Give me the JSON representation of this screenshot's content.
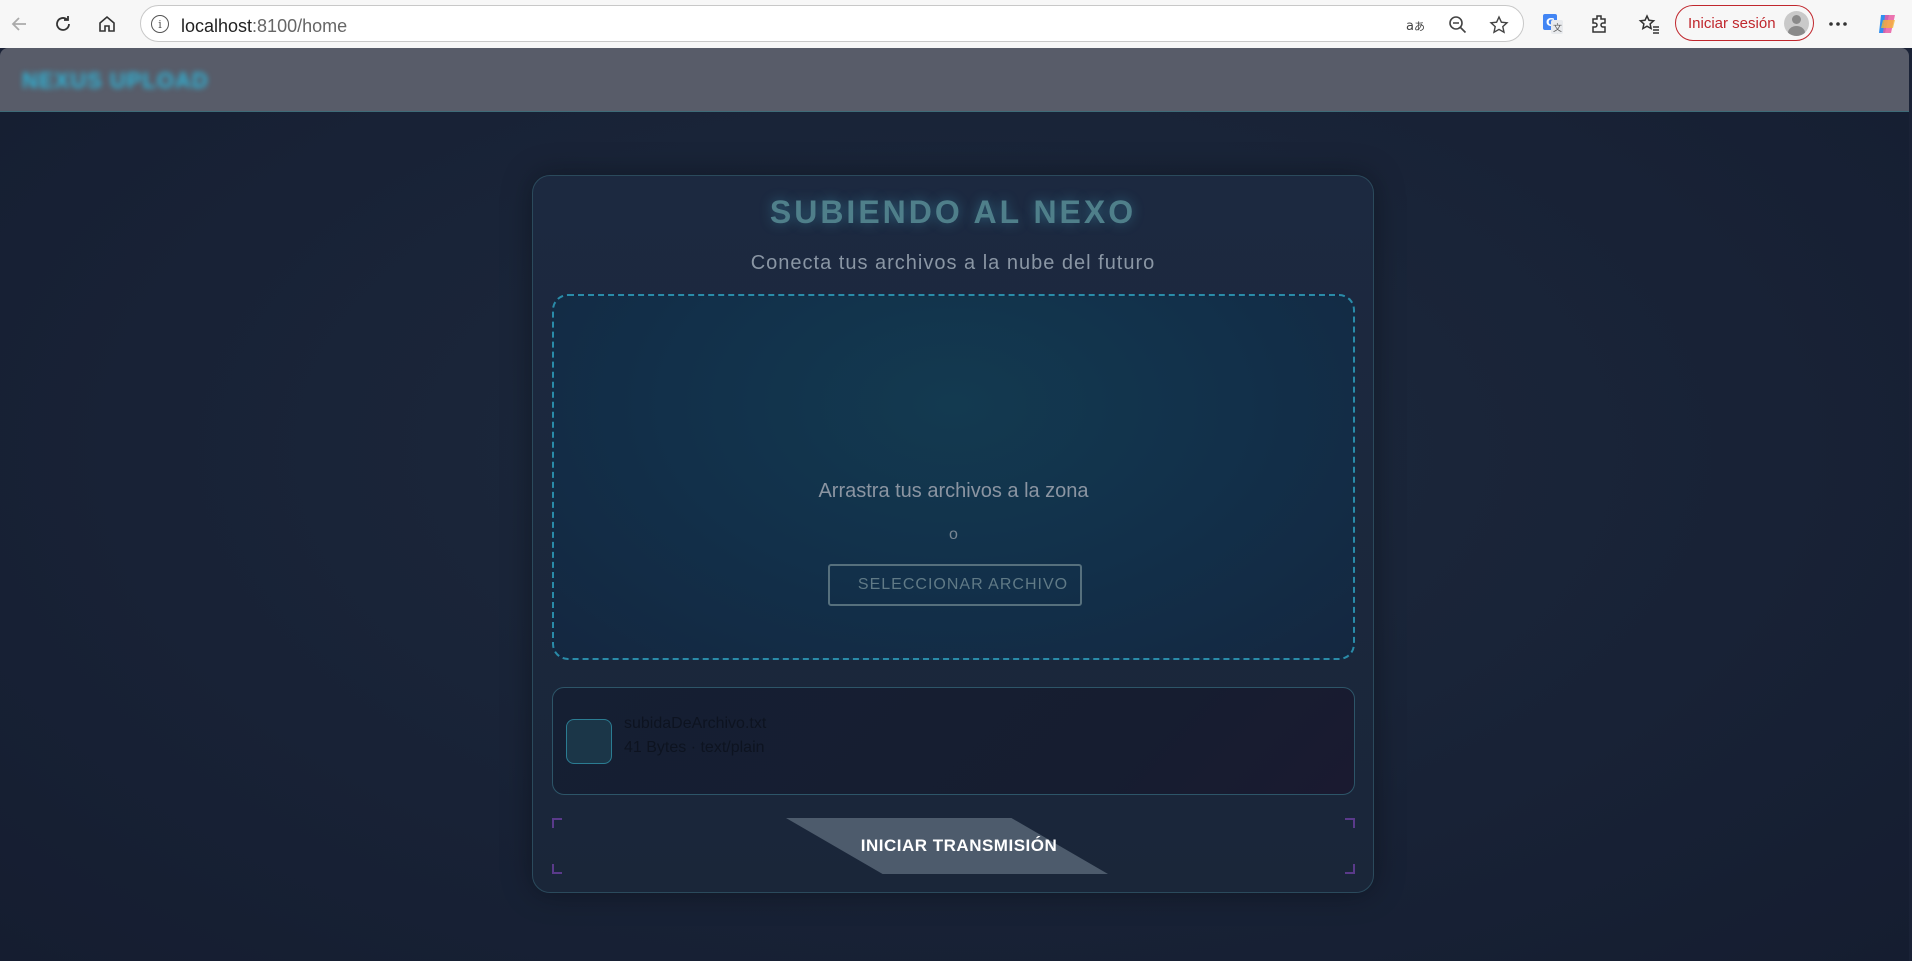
{
  "browser": {
    "url_host": "localhost",
    "url_rest": ":8100/home",
    "signin_label": "Iniciar sesión"
  },
  "app": {
    "header_title": "NEXUS UPLOAD",
    "card_title": "SUBIENDO AL NEXO",
    "card_subtitle": "Conecta tus archivos a la nube del futuro",
    "dropzone": {
      "instruction": "Arrastra tus archivos a la zona",
      "or_text": "o",
      "select_button": "SELECCIONAR ARCHIVO"
    },
    "file": {
      "name": "subidaDeArchivo.txt",
      "meta": "41 Bytes · text/plain"
    },
    "transmit_button": "INICIAR TRANSMISIÓN"
  },
  "colors": {
    "accent": "#2fb5d8",
    "signin": "#c0272d",
    "background": "#1a2236"
  }
}
